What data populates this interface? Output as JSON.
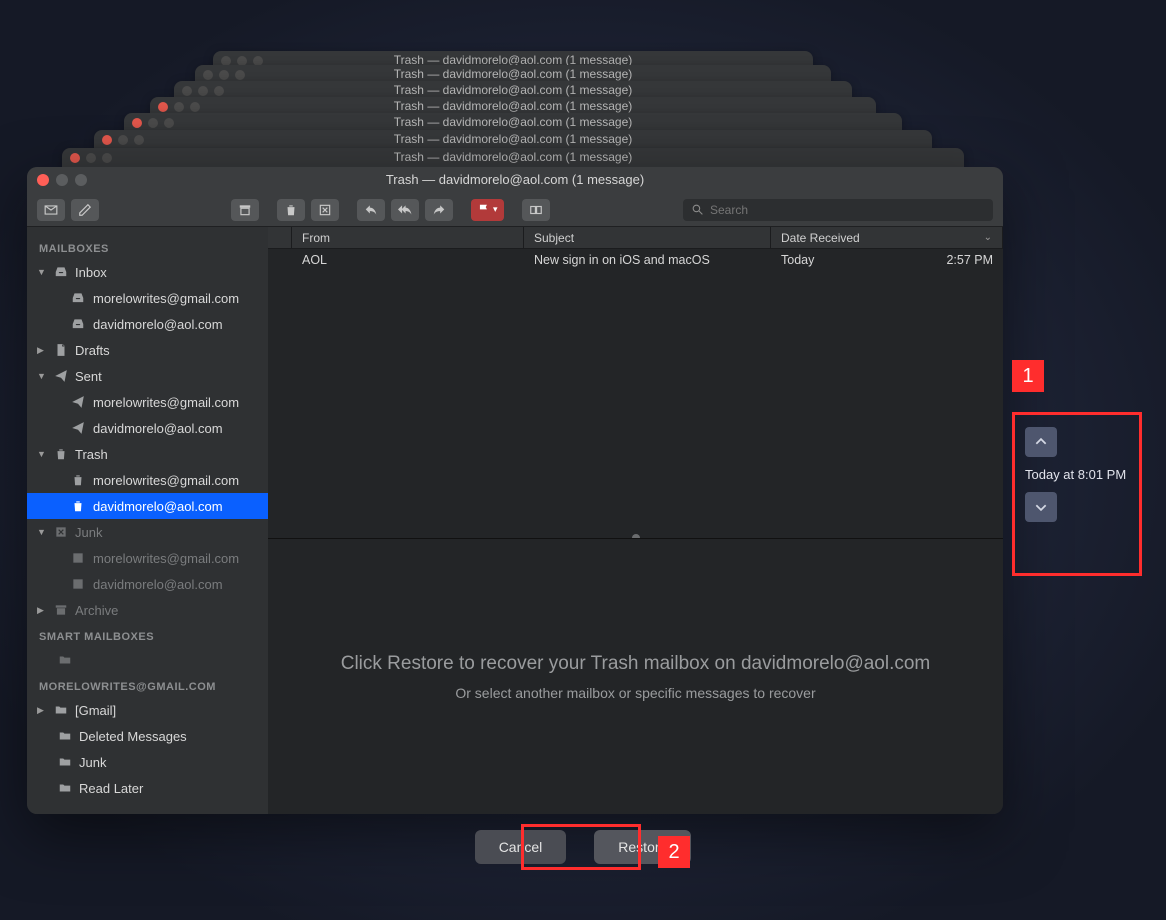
{
  "stacked_titles": [
    "Trash — davidmorelo@aol.com (1 message)",
    "Trash — davidmorelo@aol.com (1 message)",
    "Trash — davidmorelo@aol.com (1 message)",
    "Trash — davidmorelo@aol.com (1 message)",
    "Trash — davidmorelo@aol.com (1 message)",
    "Trash — davidmorelo@aol.com (1 message)",
    "Trash — davidmorelo@aol.com (1 message)"
  ],
  "window": {
    "title": "Trash — davidmorelo@aol.com (1 message)"
  },
  "search": {
    "placeholder": "Search"
  },
  "sidebar": {
    "section_mailboxes": "MAILBOXES",
    "inbox": "Inbox",
    "inbox_children": [
      "morelowrites@gmail.com",
      "davidmorelo@aol.com"
    ],
    "drafts": "Drafts",
    "sent": "Sent",
    "sent_children": [
      "morelowrites@gmail.com",
      "davidmorelo@aol.com"
    ],
    "trash": "Trash",
    "trash_children": [
      "morelowrites@gmail.com",
      "davidmorelo@aol.com"
    ],
    "junk": "Junk",
    "junk_children": [
      "morelowrites@gmail.com",
      "davidmorelo@aol.com"
    ],
    "archive": "Archive",
    "section_smart": "SMART MAILBOXES",
    "section_account": "MORELOWRITES@GMAIL.COM",
    "gmail": "[Gmail]",
    "deleted": "Deleted Messages",
    "junk2": "Junk",
    "readlater": "Read Later"
  },
  "columns": {
    "from": "From",
    "subject": "Subject",
    "date": "Date Received"
  },
  "message": {
    "from": "AOL",
    "subject": "New sign in on iOS and macOS",
    "date_day": "Today",
    "date_time": "2:57 PM"
  },
  "recover": {
    "line1": "Click Restore to recover your Trash mailbox on davidmorelo@aol.com",
    "line2": "Or select another mailbox or specific messages to recover"
  },
  "timemachine": {
    "label": "Today at 8:01 PM"
  },
  "buttons": {
    "cancel": "Cancel",
    "restore": "Restore"
  },
  "callouts": {
    "c1": "1",
    "c2": "2"
  }
}
